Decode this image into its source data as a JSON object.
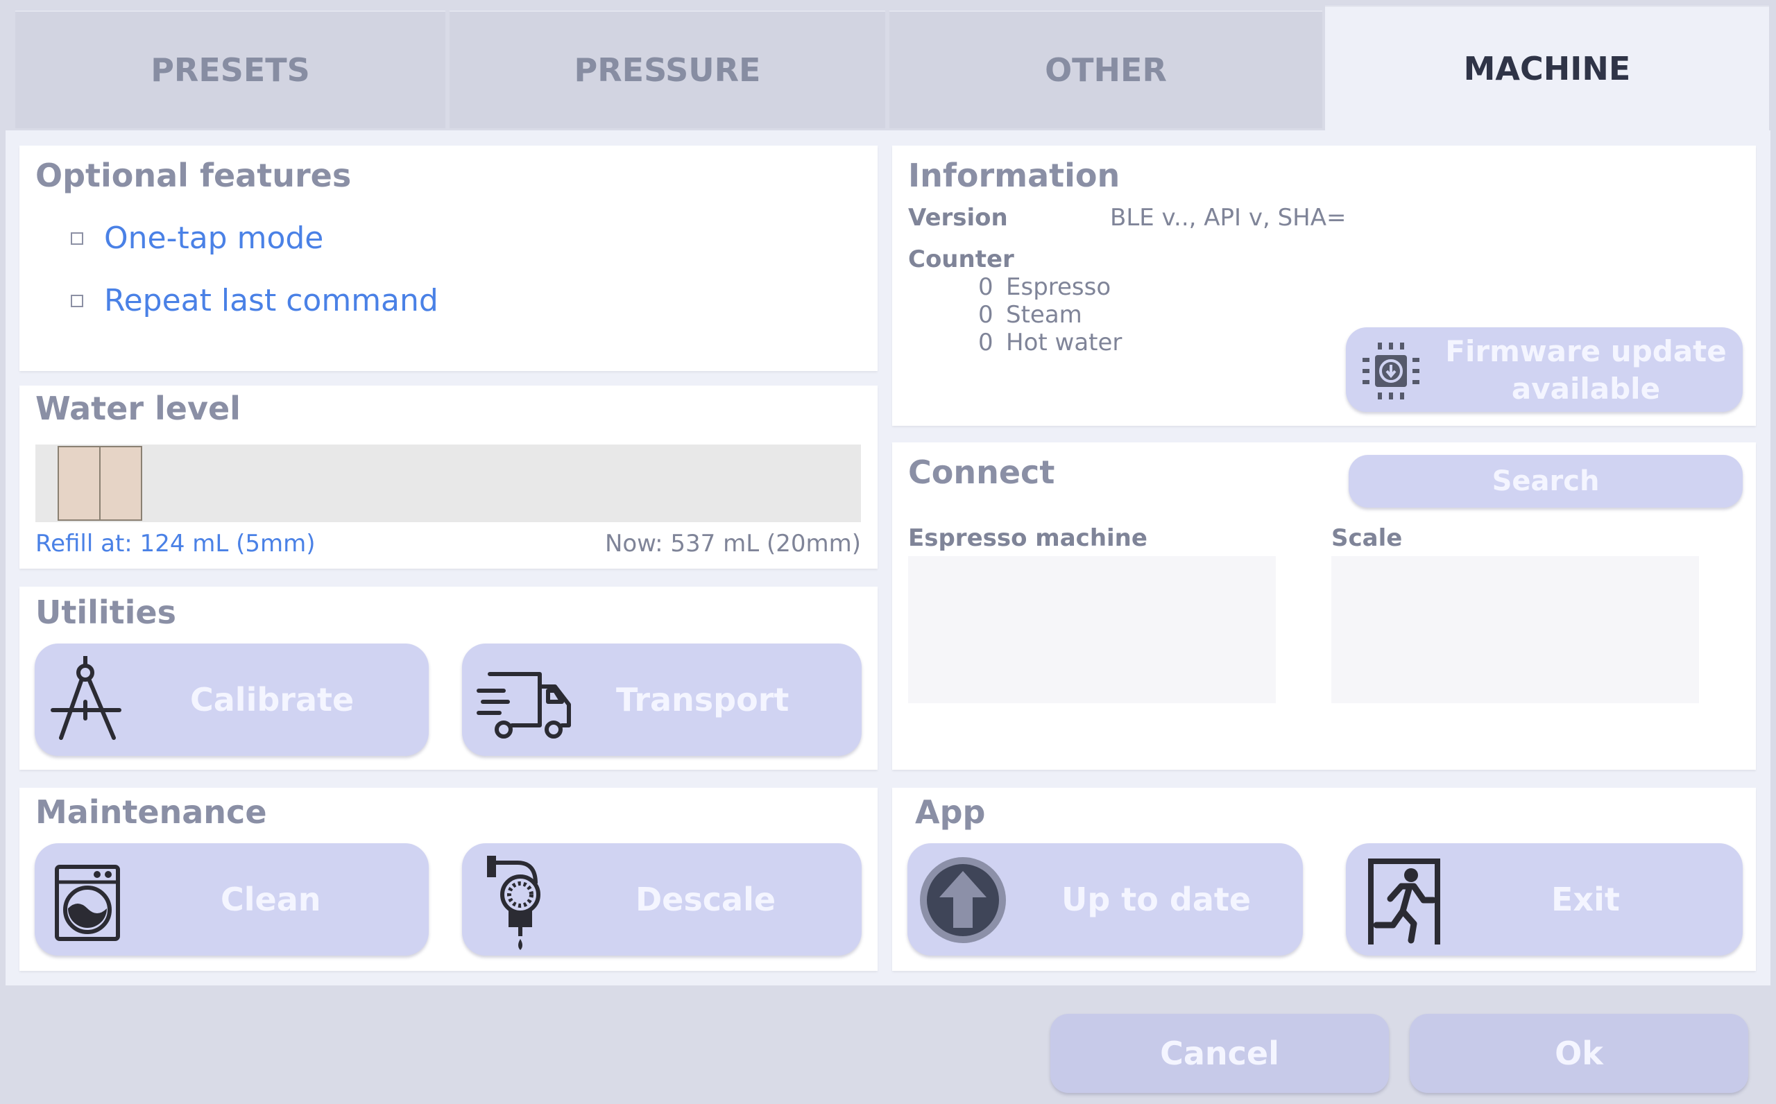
{
  "tabs": [
    {
      "label": "PRESETS"
    },
    {
      "label": "PRESSURE"
    },
    {
      "label": "OTHER"
    },
    {
      "label": "MACHINE"
    }
  ],
  "optional_features": {
    "title": "Optional features",
    "items": [
      {
        "label": "One-tap mode",
        "checked": false
      },
      {
        "label": "Repeat last command",
        "checked": false
      }
    ]
  },
  "water_level": {
    "title": "Water level",
    "refill": "Refill at: 124 mL (5mm)",
    "now": "Now: 537 mL (20mm)"
  },
  "utilities": {
    "title": "Utilities",
    "calibrate": "Calibrate",
    "transport": "Transport"
  },
  "maintenance": {
    "title": "Maintenance",
    "clean": "Clean",
    "descale": "Descale"
  },
  "information": {
    "title": "Information",
    "version_label": "Version",
    "version_value": "BLE v.., API v, SHA=",
    "counter_label": "Counter",
    "counters": [
      {
        "count": "0",
        "label": "Espresso"
      },
      {
        "count": "0",
        "label": "Steam"
      },
      {
        "count": "0",
        "label": "Hot water"
      }
    ],
    "firmware_line1": "Firmware update",
    "firmware_line2": "available"
  },
  "connect": {
    "title": "Connect",
    "search": "Search",
    "espresso_label": "Espresso machine",
    "scale_label": "Scale"
  },
  "app": {
    "title": "App",
    "update": "Up to date",
    "exit": "Exit"
  },
  "footer": {
    "cancel": "Cancel",
    "ok": "Ok"
  },
  "colors": {
    "accent_link": "#4a81e6",
    "button_fill": "#d0d3f2",
    "active_tab_text": "#2f3447"
  }
}
